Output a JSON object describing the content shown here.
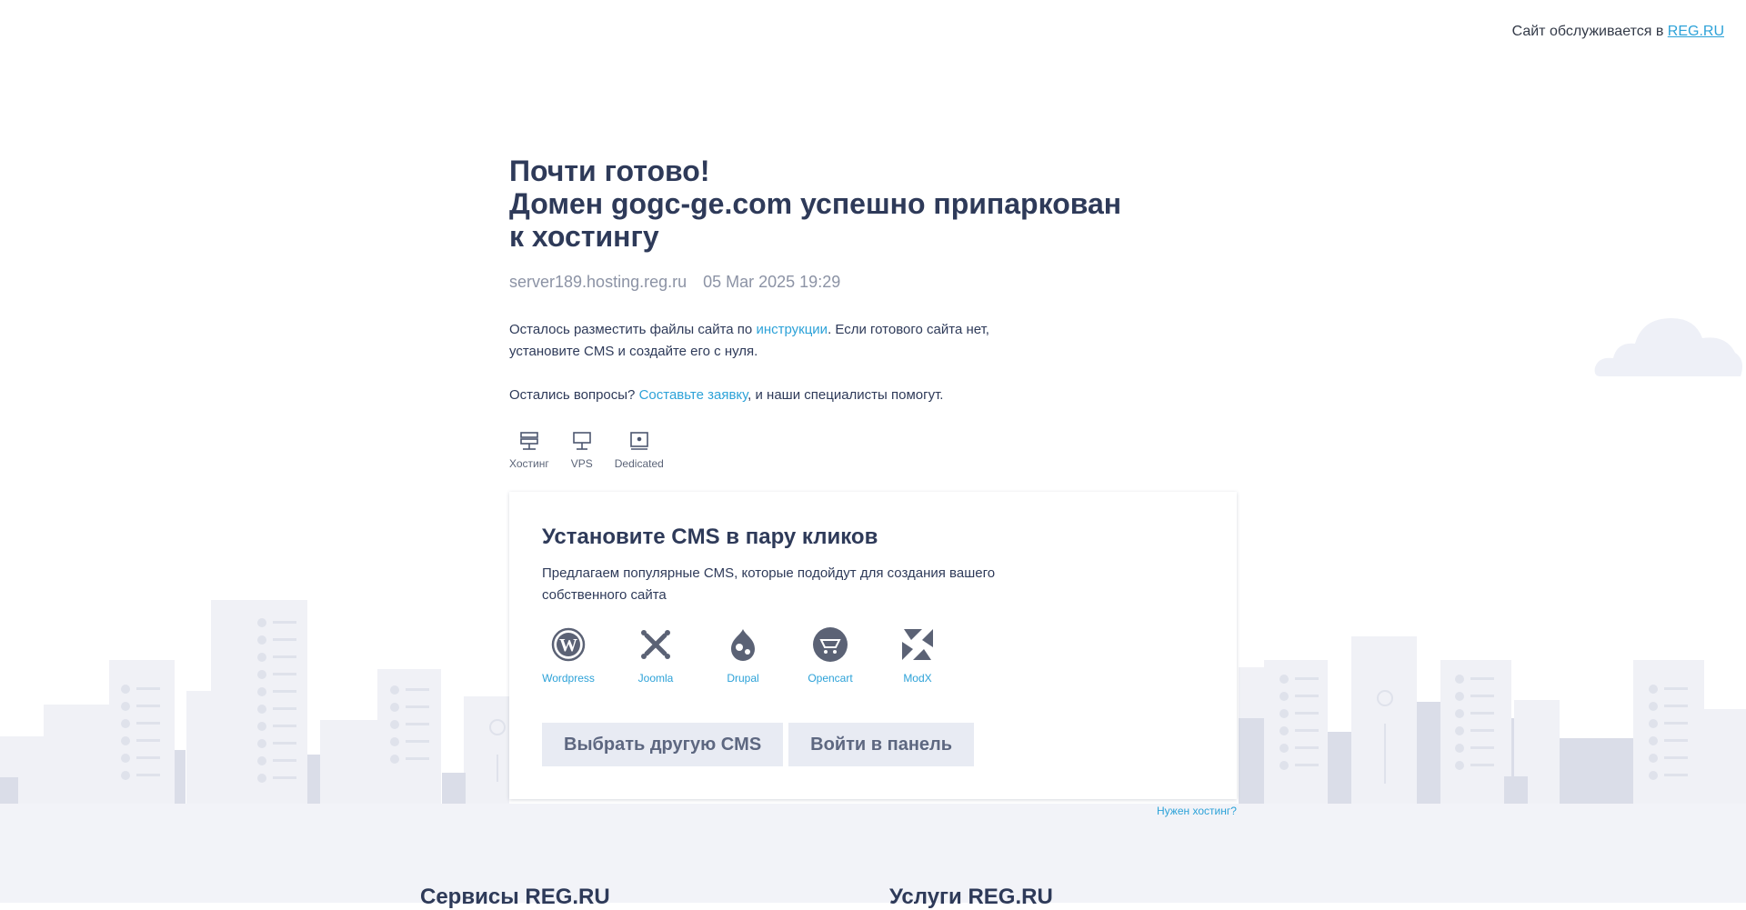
{
  "topbar": {
    "text": "Сайт обслуживается в ",
    "link": "REG.RU"
  },
  "heading": {
    "line1": "Почти готово!",
    "line2": "Домен gogc-ge.com успешно припаркован",
    "line3": "к хостингу"
  },
  "meta": {
    "server": "server189.hosting.reg.ru",
    "date": "05 Mar 2025 19:29"
  },
  "para1": {
    "before": "Осталось разместить файлы сайта по ",
    "link": "инструкции",
    "after": ". Если готового сайта нет, установите CMS и создайте его с нуля."
  },
  "para2": {
    "before": "Остались вопросы? ",
    "link": "Составьте заявку",
    "after": ", и наши специалисты помогут."
  },
  "services": [
    {
      "label": "Хостинг",
      "icon": "hosting-icon"
    },
    {
      "label": "VPS",
      "icon": "vps-icon"
    },
    {
      "label": "Dedicated",
      "icon": "dedicated-icon"
    }
  ],
  "card": {
    "title": "Установите CMS в пару кликов",
    "desc": "Предлагаем популярные CMS, которые подойдут для создания вашего собственного сайта",
    "cms": [
      {
        "label": "Wordpress",
        "icon": "wordpress-icon"
      },
      {
        "label": "Joomla",
        "icon": "joomla-icon"
      },
      {
        "label": "Drupal",
        "icon": "drupal-icon"
      },
      {
        "label": "Opencart",
        "icon": "opencart-icon"
      },
      {
        "label": "ModX",
        "icon": "modx-icon"
      }
    ],
    "btn_other": "Выбрать другую CMS",
    "btn_panel": "Войти в панель"
  },
  "need_hosting": "Нужен хостинг?",
  "footer": {
    "col1": "Сервисы REG.RU",
    "col2": "Услуги REG.RU"
  },
  "colors": {
    "accent": "#2da2d8",
    "text": "#2e3a59",
    "muted": "#8c93a5",
    "button_bg": "#e8ebf3"
  }
}
